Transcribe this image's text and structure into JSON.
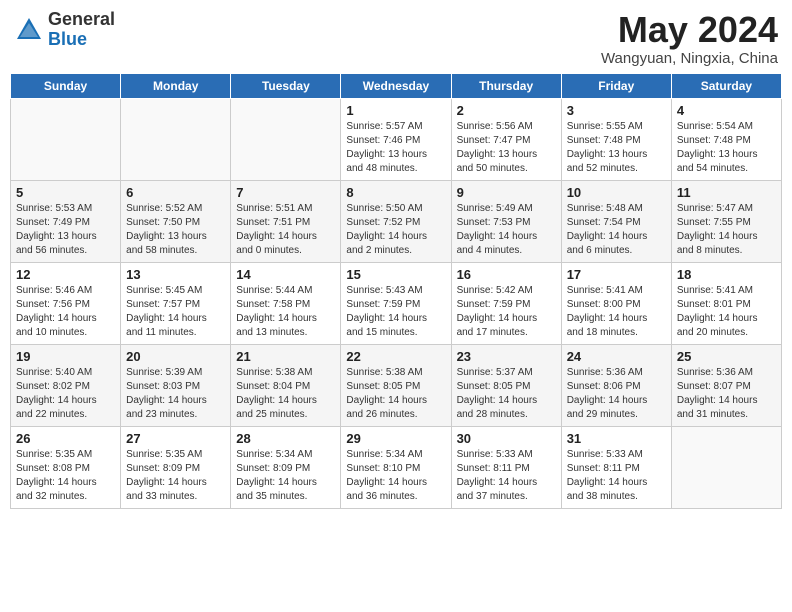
{
  "header": {
    "logo_general": "General",
    "logo_blue": "Blue",
    "month_year": "May 2024",
    "location": "Wangyuan, Ningxia, China"
  },
  "days_of_week": [
    "Sunday",
    "Monday",
    "Tuesday",
    "Wednesday",
    "Thursday",
    "Friday",
    "Saturday"
  ],
  "weeks": [
    [
      {
        "day": "",
        "info": ""
      },
      {
        "day": "",
        "info": ""
      },
      {
        "day": "",
        "info": ""
      },
      {
        "day": "1",
        "info": "Sunrise: 5:57 AM\nSunset: 7:46 PM\nDaylight: 13 hours\nand 48 minutes."
      },
      {
        "day": "2",
        "info": "Sunrise: 5:56 AM\nSunset: 7:47 PM\nDaylight: 13 hours\nand 50 minutes."
      },
      {
        "day": "3",
        "info": "Sunrise: 5:55 AM\nSunset: 7:48 PM\nDaylight: 13 hours\nand 52 minutes."
      },
      {
        "day": "4",
        "info": "Sunrise: 5:54 AM\nSunset: 7:48 PM\nDaylight: 13 hours\nand 54 minutes."
      }
    ],
    [
      {
        "day": "5",
        "info": "Sunrise: 5:53 AM\nSunset: 7:49 PM\nDaylight: 13 hours\nand 56 minutes."
      },
      {
        "day": "6",
        "info": "Sunrise: 5:52 AM\nSunset: 7:50 PM\nDaylight: 13 hours\nand 58 minutes."
      },
      {
        "day": "7",
        "info": "Sunrise: 5:51 AM\nSunset: 7:51 PM\nDaylight: 14 hours\nand 0 minutes."
      },
      {
        "day": "8",
        "info": "Sunrise: 5:50 AM\nSunset: 7:52 PM\nDaylight: 14 hours\nand 2 minutes."
      },
      {
        "day": "9",
        "info": "Sunrise: 5:49 AM\nSunset: 7:53 PM\nDaylight: 14 hours\nand 4 minutes."
      },
      {
        "day": "10",
        "info": "Sunrise: 5:48 AM\nSunset: 7:54 PM\nDaylight: 14 hours\nand 6 minutes."
      },
      {
        "day": "11",
        "info": "Sunrise: 5:47 AM\nSunset: 7:55 PM\nDaylight: 14 hours\nand 8 minutes."
      }
    ],
    [
      {
        "day": "12",
        "info": "Sunrise: 5:46 AM\nSunset: 7:56 PM\nDaylight: 14 hours\nand 10 minutes."
      },
      {
        "day": "13",
        "info": "Sunrise: 5:45 AM\nSunset: 7:57 PM\nDaylight: 14 hours\nand 11 minutes."
      },
      {
        "day": "14",
        "info": "Sunrise: 5:44 AM\nSunset: 7:58 PM\nDaylight: 14 hours\nand 13 minutes."
      },
      {
        "day": "15",
        "info": "Sunrise: 5:43 AM\nSunset: 7:59 PM\nDaylight: 14 hours\nand 15 minutes."
      },
      {
        "day": "16",
        "info": "Sunrise: 5:42 AM\nSunset: 7:59 PM\nDaylight: 14 hours\nand 17 minutes."
      },
      {
        "day": "17",
        "info": "Sunrise: 5:41 AM\nSunset: 8:00 PM\nDaylight: 14 hours\nand 18 minutes."
      },
      {
        "day": "18",
        "info": "Sunrise: 5:41 AM\nSunset: 8:01 PM\nDaylight: 14 hours\nand 20 minutes."
      }
    ],
    [
      {
        "day": "19",
        "info": "Sunrise: 5:40 AM\nSunset: 8:02 PM\nDaylight: 14 hours\nand 22 minutes."
      },
      {
        "day": "20",
        "info": "Sunrise: 5:39 AM\nSunset: 8:03 PM\nDaylight: 14 hours\nand 23 minutes."
      },
      {
        "day": "21",
        "info": "Sunrise: 5:38 AM\nSunset: 8:04 PM\nDaylight: 14 hours\nand 25 minutes."
      },
      {
        "day": "22",
        "info": "Sunrise: 5:38 AM\nSunset: 8:05 PM\nDaylight: 14 hours\nand 26 minutes."
      },
      {
        "day": "23",
        "info": "Sunrise: 5:37 AM\nSunset: 8:05 PM\nDaylight: 14 hours\nand 28 minutes."
      },
      {
        "day": "24",
        "info": "Sunrise: 5:36 AM\nSunset: 8:06 PM\nDaylight: 14 hours\nand 29 minutes."
      },
      {
        "day": "25",
        "info": "Sunrise: 5:36 AM\nSunset: 8:07 PM\nDaylight: 14 hours\nand 31 minutes."
      }
    ],
    [
      {
        "day": "26",
        "info": "Sunrise: 5:35 AM\nSunset: 8:08 PM\nDaylight: 14 hours\nand 32 minutes."
      },
      {
        "day": "27",
        "info": "Sunrise: 5:35 AM\nSunset: 8:09 PM\nDaylight: 14 hours\nand 33 minutes."
      },
      {
        "day": "28",
        "info": "Sunrise: 5:34 AM\nSunset: 8:09 PM\nDaylight: 14 hours\nand 35 minutes."
      },
      {
        "day": "29",
        "info": "Sunrise: 5:34 AM\nSunset: 8:10 PM\nDaylight: 14 hours\nand 36 minutes."
      },
      {
        "day": "30",
        "info": "Sunrise: 5:33 AM\nSunset: 8:11 PM\nDaylight: 14 hours\nand 37 minutes."
      },
      {
        "day": "31",
        "info": "Sunrise: 5:33 AM\nSunset: 8:11 PM\nDaylight: 14 hours\nand 38 minutes."
      },
      {
        "day": "",
        "info": ""
      }
    ]
  ]
}
